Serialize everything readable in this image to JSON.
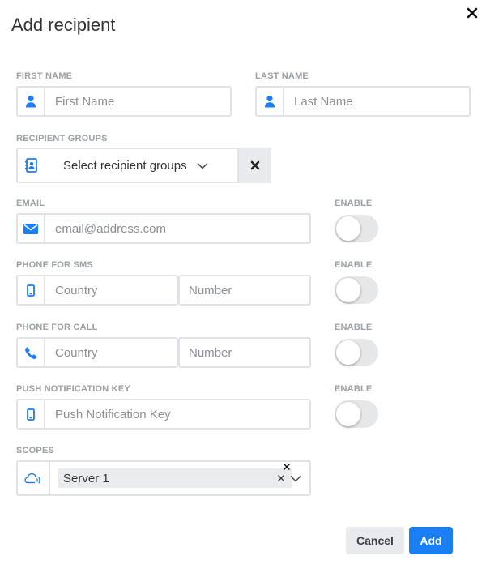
{
  "dialog": {
    "title": "Add recipient",
    "close_icon": "close-icon"
  },
  "first_name": {
    "label": "FIRST NAME",
    "placeholder": "First Name",
    "value": "",
    "icon": "user-icon"
  },
  "last_name": {
    "label": "LAST NAME",
    "placeholder": "Last Name",
    "value": "",
    "icon": "user-icon"
  },
  "recipient_groups": {
    "label": "RECIPIENT GROUPS",
    "selected": "Select recipient groups",
    "icon": "contact-book-icon"
  },
  "email": {
    "label": "EMAIL",
    "placeholder": "email@address.com",
    "value": "",
    "icon": "envelope-icon",
    "enable_label": "ENABLE",
    "enabled": false
  },
  "phone_sms": {
    "label": "PHONE FOR SMS",
    "country_placeholder": "Country",
    "number_placeholder": "Number",
    "icon": "mobile-phone-icon",
    "enable_label": "ENABLE",
    "enabled": false
  },
  "phone_call": {
    "label": "PHONE FOR CALL",
    "country_placeholder": "Country",
    "number_placeholder": "Number",
    "icon": "phone-handset-icon",
    "enable_label": "ENABLE",
    "enabled": false
  },
  "push_key": {
    "label": "PUSH NOTIFICATION KEY",
    "placeholder": "Push Notification Key",
    "value": "",
    "icon": "mobile-phone-icon",
    "enable_label": "ENABLE",
    "enabled": false
  },
  "scopes": {
    "label": "SCOPES",
    "selected": [
      "Server 1"
    ],
    "icon": "cloud-signal-icon"
  },
  "actions": {
    "cancel_label": "Cancel",
    "add_label": "Add"
  },
  "colors": {
    "accent": "#1a7ff3",
    "icon": "#1a7ff3",
    "border": "#dfe2e6",
    "label": "#9aa0a6",
    "toggle_off": "#e6e7e9"
  }
}
